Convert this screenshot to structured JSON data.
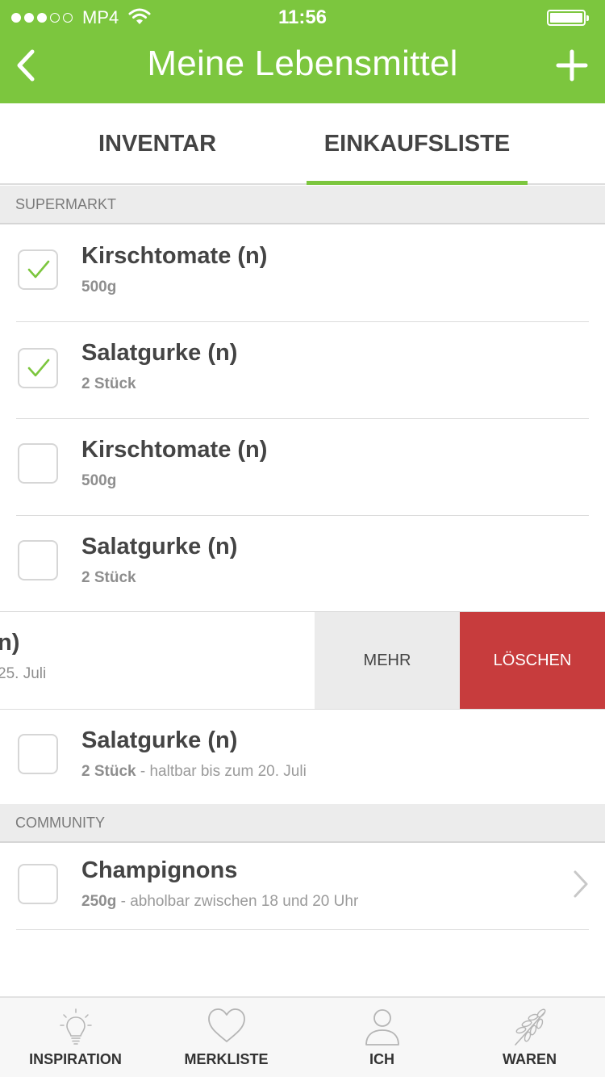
{
  "status_bar": {
    "carrier": "MP4",
    "time": "11:56",
    "signal_filled": 3,
    "signal_total": 5
  },
  "header": {
    "title": "Meine Lebensmittel",
    "accent_color": "#7cc63e"
  },
  "tabs": [
    {
      "label": "INVENTAR",
      "active": false
    },
    {
      "label": "EINKAUFSLISTE",
      "active": true
    }
  ],
  "sections": {
    "supermarket": "SUPERMARKT",
    "community": "COMMUNITY"
  },
  "items": [
    {
      "name": "Kirschtomate (n)",
      "qty": "500g",
      "checked": true
    },
    {
      "name": "Salatgurke (n)",
      "qty": "2 Stück",
      "checked": true
    },
    {
      "name": "Kirschtomate (n)",
      "qty": "500g",
      "checked": false
    },
    {
      "name": "Salatgurke (n)",
      "qty": "2 Stück",
      "checked": false
    }
  ],
  "swiped_item": {
    "name_visible": "n)",
    "sub_visible": "25. Juli",
    "more_label": "MEHR",
    "delete_label": "LÖSCHEN",
    "delete_color": "#c73c3d"
  },
  "item_with_note": {
    "name": "Salatgurke (n)",
    "qty": "2 Stück",
    "note": " - haltbar bis zum 20. Juli",
    "checked": false
  },
  "community_item": {
    "name": "Champignons",
    "qty": "250g",
    "note": " - abholbar zwischen 18 und 20 Uhr",
    "checked": false
  },
  "tabbar": [
    {
      "label": "INSPIRATION",
      "icon": "lightbulb-icon"
    },
    {
      "label": "MERKLISTE",
      "icon": "heart-icon"
    },
    {
      "label": "ICH",
      "icon": "person-icon"
    },
    {
      "label": "WAREN",
      "icon": "wheat-icon"
    }
  ]
}
